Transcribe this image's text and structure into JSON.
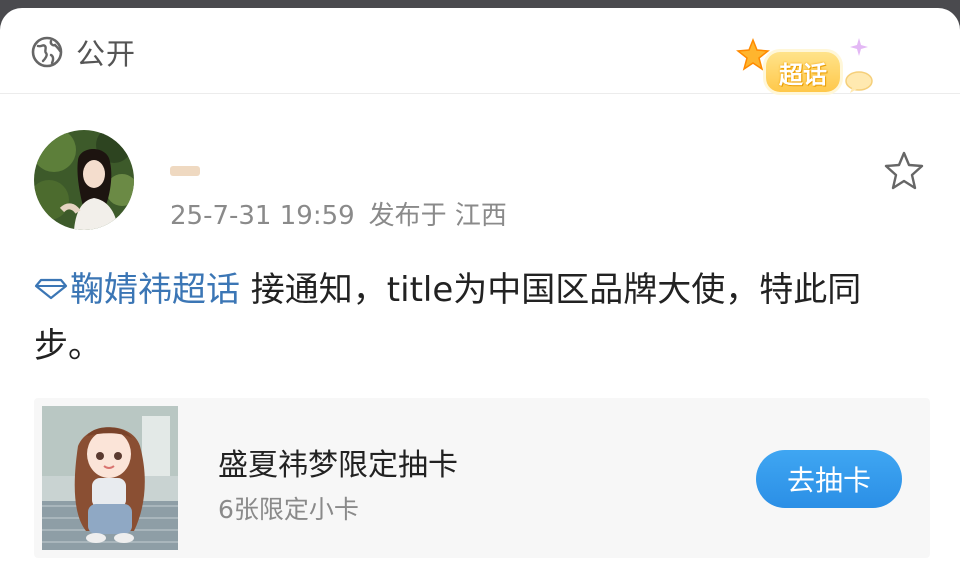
{
  "topbar": {
    "visibility_icon": "globe-icon",
    "visibility_label": "公开",
    "supertopic_badge_label": "超话"
  },
  "post": {
    "username": "",
    "timestamp": "25-7-31 19:59",
    "location": "发布于 江西",
    "favorite_icon": "star-outline-icon",
    "topic_icon": "diamond-icon",
    "topic_link": "鞠婧祎超话",
    "body_text": " 接通知，title为中国区品牌大使，特此同步。"
  },
  "card": {
    "title": "盛夏祎梦限定抽卡",
    "subtitle": "6张限定小卡",
    "button_label": "去抽卡"
  },
  "colors": {
    "link": "#3b76b5",
    "button": "#2b8fe6",
    "meta_text": "#8a8a8a",
    "badge": "#ffc84a"
  }
}
